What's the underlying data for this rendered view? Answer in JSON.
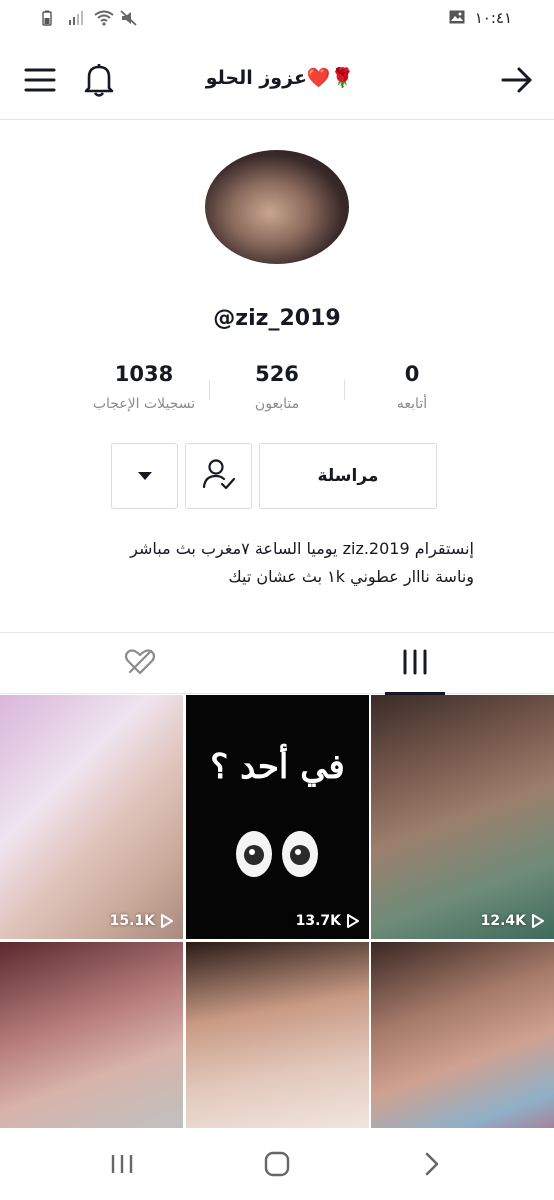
{
  "status_bar": {
    "time": "١٠:٤١",
    "icons": [
      "battery-icon",
      "signal-icon",
      "wifi-icon",
      "mute-icon",
      "gallery-icon"
    ]
  },
  "header": {
    "title": "عزوز الحلو❤️🌹",
    "menu_icon": "menu-icon",
    "bell_icon": "bell-icon",
    "back_icon": "arrow-right-icon"
  },
  "profile": {
    "handle": "@ziz_2019",
    "stats": {
      "likes": {
        "value": "1038",
        "label": "تسجيلات الإعجاب"
      },
      "followers": {
        "value": "526",
        "label": "متابعون"
      },
      "following": {
        "value": "0",
        "label": "أتابعه"
      }
    },
    "buttons": {
      "message": "مراسلة"
    },
    "bio_line1": "إنستقرام ziz.2019 يوميا الساعة ٧مغرب بث مباشر",
    "bio_line2": "وناسة نااار عطوني ١k بث عشان تيك"
  },
  "tabs": {
    "videos_icon": "grid-icon",
    "liked_icon": "hidden-heart-icon"
  },
  "videos": [
    {
      "views": "15.1K"
    },
    {
      "views": "13.7K",
      "overlay_text": "في أحد ؟"
    },
    {
      "views": "12.4K"
    },
    {
      "views": ""
    },
    {
      "views": ""
    },
    {
      "views": ""
    }
  ],
  "nav": {
    "recents_icon": "recents-icon",
    "home_icon": "home-icon",
    "back_icon": "back-icon"
  }
}
